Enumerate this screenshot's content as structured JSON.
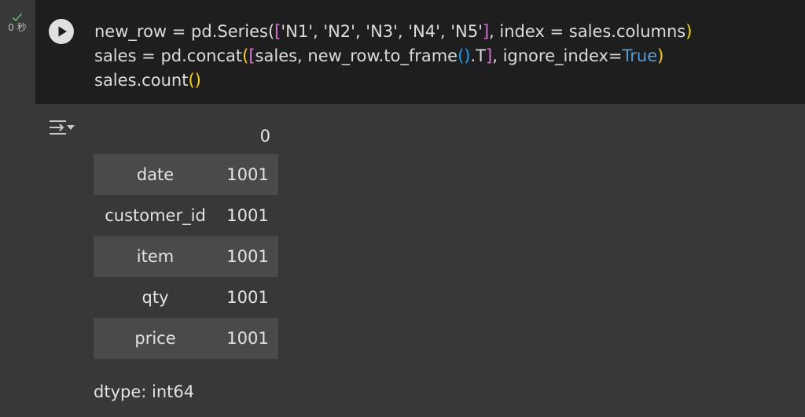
{
  "cell": {
    "status": {
      "icon": "check-icon",
      "exec_time": "0 秒"
    },
    "run_button_icon": "play-icon",
    "code_lines": [
      {
        "tokens": [
          {
            "t": "new_row = pd.Series(",
            "c": "plain"
          },
          {
            "t": "[",
            "c": "bracket-p"
          },
          {
            "t": "'N1', 'N2', 'N3', 'N4', 'N5'",
            "c": "plain"
          },
          {
            "t": "]",
            "c": "bracket-p"
          },
          {
            "t": ", index = sales.columns",
            "c": "plain"
          },
          {
            "t": ")",
            "c": "bracket-y"
          }
        ]
      },
      {
        "tokens": [
          {
            "t": "sales = pd.concat",
            "c": "plain"
          },
          {
            "t": "(",
            "c": "bracket-y"
          },
          {
            "t": "[",
            "c": "bracket-p"
          },
          {
            "t": "sales, new_row.to_frame",
            "c": "plain"
          },
          {
            "t": "()",
            "c": "bracket-b"
          },
          {
            "t": ".T",
            "c": "plain"
          },
          {
            "t": "]",
            "c": "bracket-p"
          },
          {
            "t": ", ignore_index=",
            "c": "plain"
          },
          {
            "t": "True",
            "c": "kw"
          },
          {
            "t": ")",
            "c": "bracket-y"
          }
        ]
      },
      {
        "tokens": [
          {
            "t": "sales.count",
            "c": "plain"
          },
          {
            "t": "()",
            "c": "bracket-y"
          }
        ]
      }
    ]
  },
  "output": {
    "toggle_icon": "output-toggle-icon",
    "column_header": "0",
    "rows": [
      {
        "index": "date",
        "value": "1001"
      },
      {
        "index": "customer_id",
        "value": "1001"
      },
      {
        "index": "item",
        "value": "1001"
      },
      {
        "index": "qty",
        "value": "1001"
      },
      {
        "index": "price",
        "value": "1001"
      }
    ],
    "dtype": "dtype: int64"
  },
  "colors": {
    "background": "#383838",
    "code_background": "#1e1e1e",
    "string": "#ce9178",
    "bracket_yellow": "#ffd700",
    "bracket_purple": "#da70d6",
    "bracket_blue": "#179fff",
    "keyword": "#569cd6",
    "success_check": "#5fb96a"
  }
}
